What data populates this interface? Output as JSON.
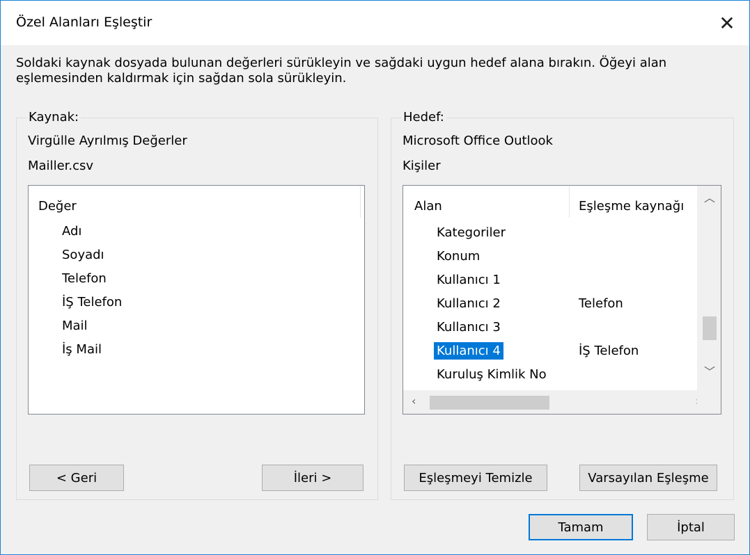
{
  "window": {
    "title": "Özel Alanları Eşleştir"
  },
  "instructions": "Soldaki kaynak dosyada bulunan değerleri sürükleyin ve sağdaki uygun hedef alana bırakın. Öğeyi alan eşlemesinden kaldırmak için sağdan sola sürükleyin.",
  "source": {
    "legend": "Kaynak:",
    "type": "Virgülle Ayrılmış Değerler",
    "file": "Mailler.csv",
    "column_header": "Değer",
    "items": [
      "Adı",
      "Soyadı",
      "Telefon",
      "İŞ Telefon",
      "Mail",
      "İş Mail"
    ],
    "back_button": "< Geri",
    "next_button": "İleri >"
  },
  "target": {
    "legend": "Hedef:",
    "app": "Microsoft Office Outlook",
    "folder": "Kişiler",
    "columns": {
      "field": "Alan",
      "mapped_from": "Eşleşme kaynağı"
    },
    "rows": [
      {
        "field": "Kategoriler",
        "mapped_from": ""
      },
      {
        "field": "Konum",
        "mapped_from": ""
      },
      {
        "field": "Kullanıcı 1",
        "mapped_from": ""
      },
      {
        "field": "Kullanıcı 2",
        "mapped_from": "Telefon"
      },
      {
        "field": "Kullanıcı 3",
        "mapped_from": ""
      },
      {
        "field": "Kullanıcı 4",
        "mapped_from": "İŞ Telefon",
        "selected": true
      },
      {
        "field": "Kuruluş Kimlik No",
        "mapped_from": ""
      }
    ],
    "clear_button": "Eşleşmeyi Temizle",
    "default_button": "Varsayılan Eşleşme"
  },
  "footer": {
    "ok_button": "Tamam",
    "cancel_button": "İptal"
  },
  "colors": {
    "accent": "#0078d7",
    "window_border": "#1883d7"
  }
}
